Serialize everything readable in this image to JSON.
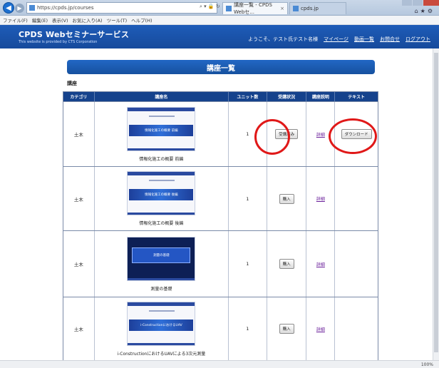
{
  "browser": {
    "address": "https://cpds.jp/courses",
    "tabs": [
      {
        "label": "講座一覧 - CPDS Webセ..."
      },
      {
        "label": "cpds.jp"
      }
    ],
    "menu": [
      "ファイル(F)",
      "編集(E)",
      "表示(V)",
      "お気に入り(A)",
      "ツール(T)",
      "ヘルプ(H)"
    ],
    "zoom": "100%"
  },
  "site": {
    "logo": "CPDS Webセミナーサービス",
    "logo_sub": "This website is provided by CTS Corporation",
    "welcome": "ようこそ、テスト氏テスト名様",
    "nav": [
      "マイページ",
      "動画一覧",
      "お問合せ",
      "ログアウト"
    ]
  },
  "page": {
    "title": "講座一覧",
    "section": "講座"
  },
  "table": {
    "headers": [
      "カテゴリ",
      "講座名",
      "ユニット数",
      "受講状況",
      "講座説明",
      "テキスト"
    ],
    "rows": [
      {
        "category": "土木",
        "thumb_title": "情報化施工の概要 前編",
        "name": "情報化施工の概要 前編",
        "units": "1",
        "status": "受講済み",
        "detail": "詳細",
        "text": "ダウンロード"
      },
      {
        "category": "土木",
        "thumb_title": "情報化施工の概要 後編",
        "name": "情報化施工の概要 後編",
        "units": "1",
        "status": "購入",
        "detail": "詳細",
        "text": ""
      },
      {
        "category": "土木",
        "thumb_title": "測量の基礎",
        "name": "測量の基礎",
        "units": "1",
        "status": "購入",
        "detail": "詳細",
        "text": ""
      },
      {
        "category": "土木",
        "thumb_title": "i-ConstructionにおけるUAV",
        "name": "i-ConstructionにおけるUAVによる3次元測量",
        "units": "1",
        "status": "購入",
        "detail": "詳細",
        "text": ""
      }
    ]
  }
}
